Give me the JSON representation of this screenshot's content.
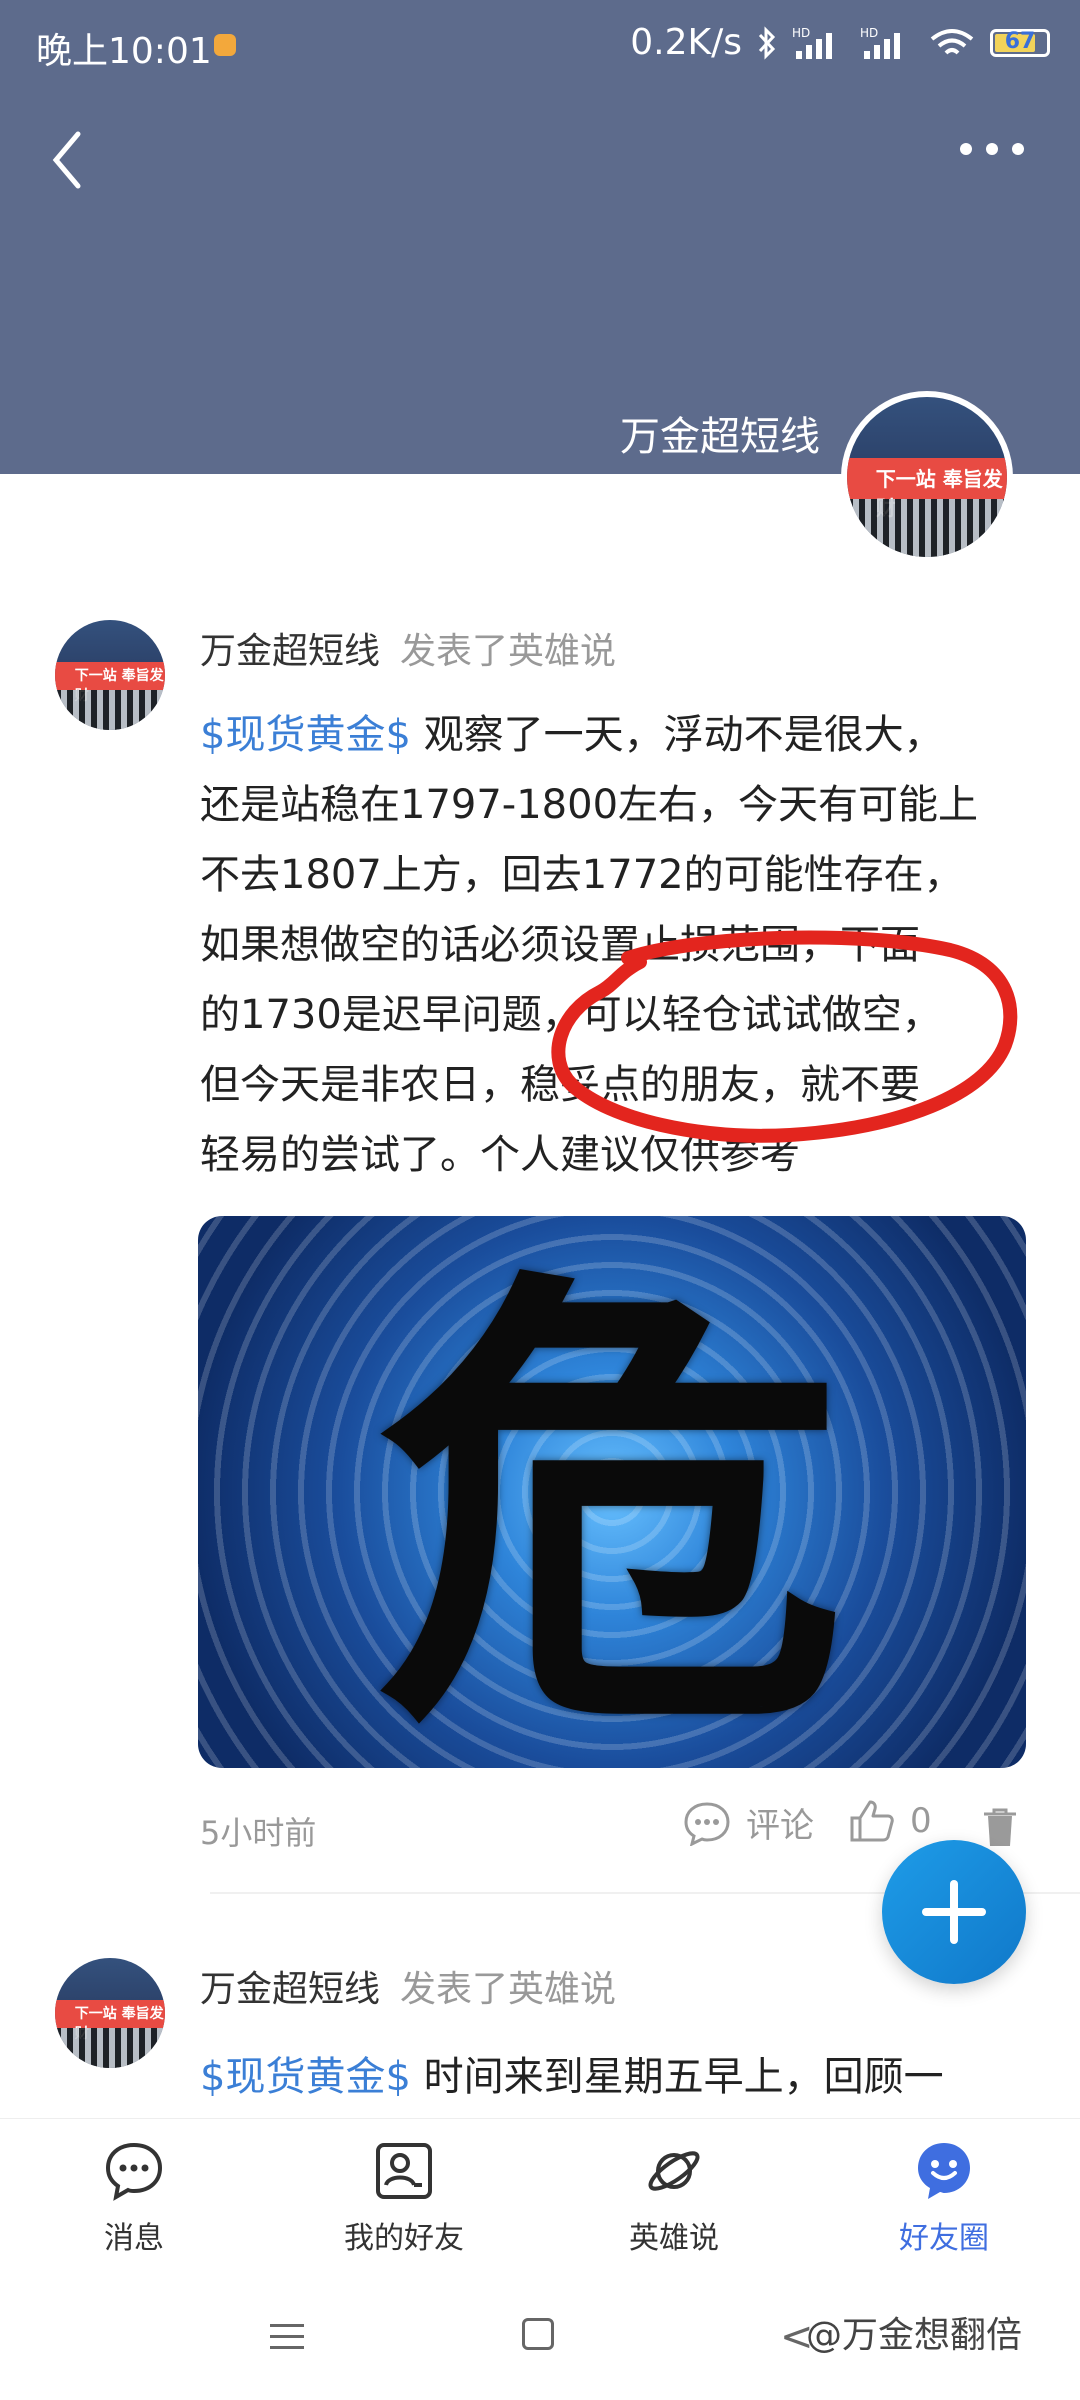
{
  "status_bar": {
    "time": "晚上10:01",
    "network_speed": "0.2K/s",
    "battery": "67"
  },
  "header": {
    "title": "万金超短线"
  },
  "posts": [
    {
      "author": "万金超短线",
      "action": "发表了英雄说",
      "tag": "$现货黄金$",
      "lines": [
        " 观察了一天，浮动不是很大，",
        "还是站稳在1797-1800左右，今天有可能上",
        "不去1807上方，回去1772的可能性存在，",
        "如果想做空的话必须设置止损范围，下面",
        "的1730是迟早问题，可以轻仓试试做空，",
        "但今天是非农日，稳妥点的朋友，就不要",
        "轻易的尝试了。个人建议仅供参考"
      ],
      "image_glyph": "危",
      "time": "5小时前",
      "comment_label": "评论",
      "like_count": "0"
    },
    {
      "author": "万金超短线",
      "action": "发表了英雄说",
      "tag": "$现货黄金$",
      "lines": [
        " 时间来到星期五早上，回顾一"
      ]
    }
  ],
  "avatar_sign_text": "下一站 奉旨发财",
  "bottom_nav": [
    {
      "label": "消息",
      "icon": "chat-bubble-icon"
    },
    {
      "label": "我的好友",
      "icon": "contact-card-icon"
    },
    {
      "label": "英雄说",
      "icon": "planet-icon"
    },
    {
      "label": "好友圈",
      "icon": "smile-bubble-icon"
    }
  ],
  "watermark": "@万金想翻倍",
  "colors": {
    "header_bg": "#5d6b8c",
    "tag": "#3b7fd6",
    "active_nav": "#3f6ee0",
    "fab": "#1a8ddc",
    "annotation": "#e3251e"
  }
}
